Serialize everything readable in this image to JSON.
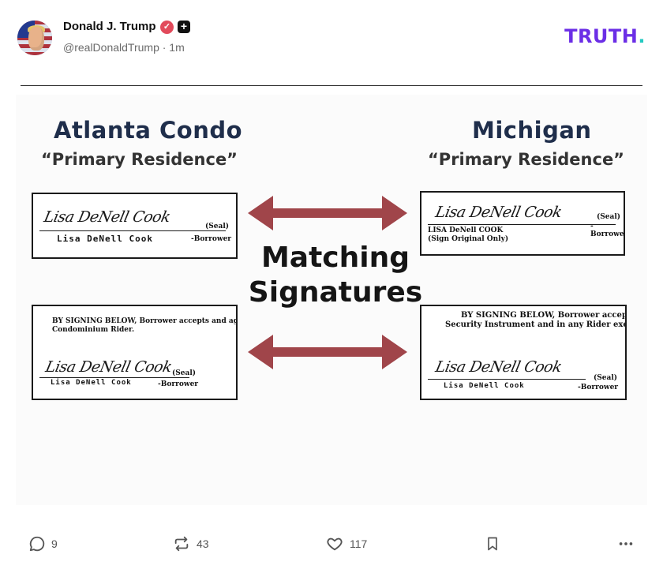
{
  "post": {
    "author": "Donald J. Trump",
    "handle": "@realDonaldTrump · 1m",
    "logo": "TRUTH",
    "logo_dot": "."
  },
  "image": {
    "left_title": "Atlanta Condo",
    "left_subtitle": "“Primary Residence”",
    "right_title": "Michigan",
    "right_subtitle": "“Primary Residence”",
    "center_line1": "Matching",
    "center_line2": "Signatures",
    "doc_tl": {
      "signature": "Lisa DeNell Cook",
      "seal": "(Seal)",
      "printed": "Lisa DeNell Cook",
      "role": "-Borrower"
    },
    "doc_tr": {
      "signature": "Lisa DeNell Cook",
      "seal": "(Seal)",
      "printed": "LISA DeNell COOK",
      "note": "(Sign Original Only)",
      "role": "-Borrower"
    },
    "doc_bl": {
      "terms1": "BY SIGNING BELOW, Borrower accepts and agrees to the",
      "terms2": "Condominium Rider.",
      "signature": "Lisa DeNell Cook",
      "seal": "(Seal)",
      "printed": "Lisa DeNell Cook",
      "role": "-Borrower"
    },
    "doc_br": {
      "terms1": "BY SIGNING BELOW, Borrower accepts and",
      "terms2": "Security Instrument and in any Rider executed by Bo",
      "signature": "Lisa DeNell Cook",
      "seal": "(Seal)",
      "printed": "Lisa DeNell Cook",
      "role": "-Borrower"
    }
  },
  "actions": {
    "replies": "9",
    "retruths": "43",
    "likes": "117"
  },
  "icons": [
    "reply-icon",
    "retruth-icon",
    "like-icon",
    "bookmark-icon",
    "more-icon",
    "verified-icon",
    "plus-icon"
  ],
  "colors": {
    "brand": "#6b2ee6",
    "brand_dot": "#23c9c1",
    "verified": "#e24a5b",
    "arrow": "#a0454a"
  }
}
